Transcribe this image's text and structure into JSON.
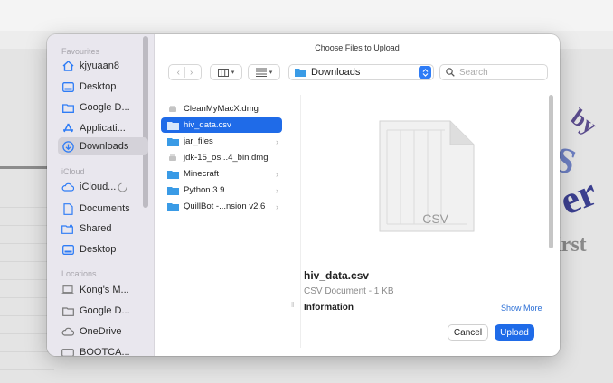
{
  "dialog_title": "Choose Files to Upload",
  "sidebar": {
    "sections": [
      {
        "heading": "Favourites",
        "items": [
          {
            "label": "kjyuaan8",
            "icon": "home-icon"
          },
          {
            "label": "Desktop",
            "icon": "desktop-icon"
          },
          {
            "label": "Google D...",
            "icon": "folder-icon"
          },
          {
            "label": "Applicati...",
            "icon": "applications-icon"
          },
          {
            "label": "Downloads",
            "icon": "download-icon",
            "selected": true
          }
        ]
      },
      {
        "heading": "iCloud",
        "items": [
          {
            "label": "iCloud... ",
            "icon": "cloud-icon"
          },
          {
            "label": "Documents",
            "icon": "document-icon"
          },
          {
            "label": "Shared",
            "icon": "shared-folder-icon"
          },
          {
            "label": "Desktop",
            "icon": "desktop-icon"
          }
        ]
      },
      {
        "heading": "Locations",
        "items": [
          {
            "label": "Kong's M...",
            "icon": "laptop-icon"
          },
          {
            "label": "Google D...",
            "icon": "folder-icon"
          },
          {
            "label": "OneDrive",
            "icon": "cloud-icon"
          },
          {
            "label": "BOOTCA...",
            "icon": "drive-icon"
          }
        ]
      }
    ]
  },
  "toolbar": {
    "location": "Downloads",
    "search_placeholder": "Search"
  },
  "files": [
    {
      "name": "CleanMyMacX.dmg",
      "type": "dmg"
    },
    {
      "name": "hiv_data.csv",
      "type": "csv",
      "selected": true
    },
    {
      "name": "jar_files",
      "type": "folder"
    },
    {
      "name": "jdk-15_os...4_bin.dmg",
      "type": "dmg"
    },
    {
      "name": "Minecraft",
      "type": "folder"
    },
    {
      "name": "Python 3.9",
      "type": "folder"
    },
    {
      "name": "QuillBot -...nsion v2.6",
      "type": "folder"
    }
  ],
  "preview": {
    "icon_label": "CSV",
    "name": "hiv_data.csv",
    "kind": "CSV Document - 1 KB",
    "info_heading": "Information",
    "show_more": "Show More"
  },
  "buttons": {
    "cancel": "Cancel",
    "upload": "Upload"
  },
  "background_logo": {
    "lines": [
      "by",
      "S",
      "er",
      "irst"
    ]
  },
  "colors": {
    "accent": "#1f6be8",
    "folder": "#3a9be6",
    "sidebar_icon": "#2e7cf6"
  }
}
